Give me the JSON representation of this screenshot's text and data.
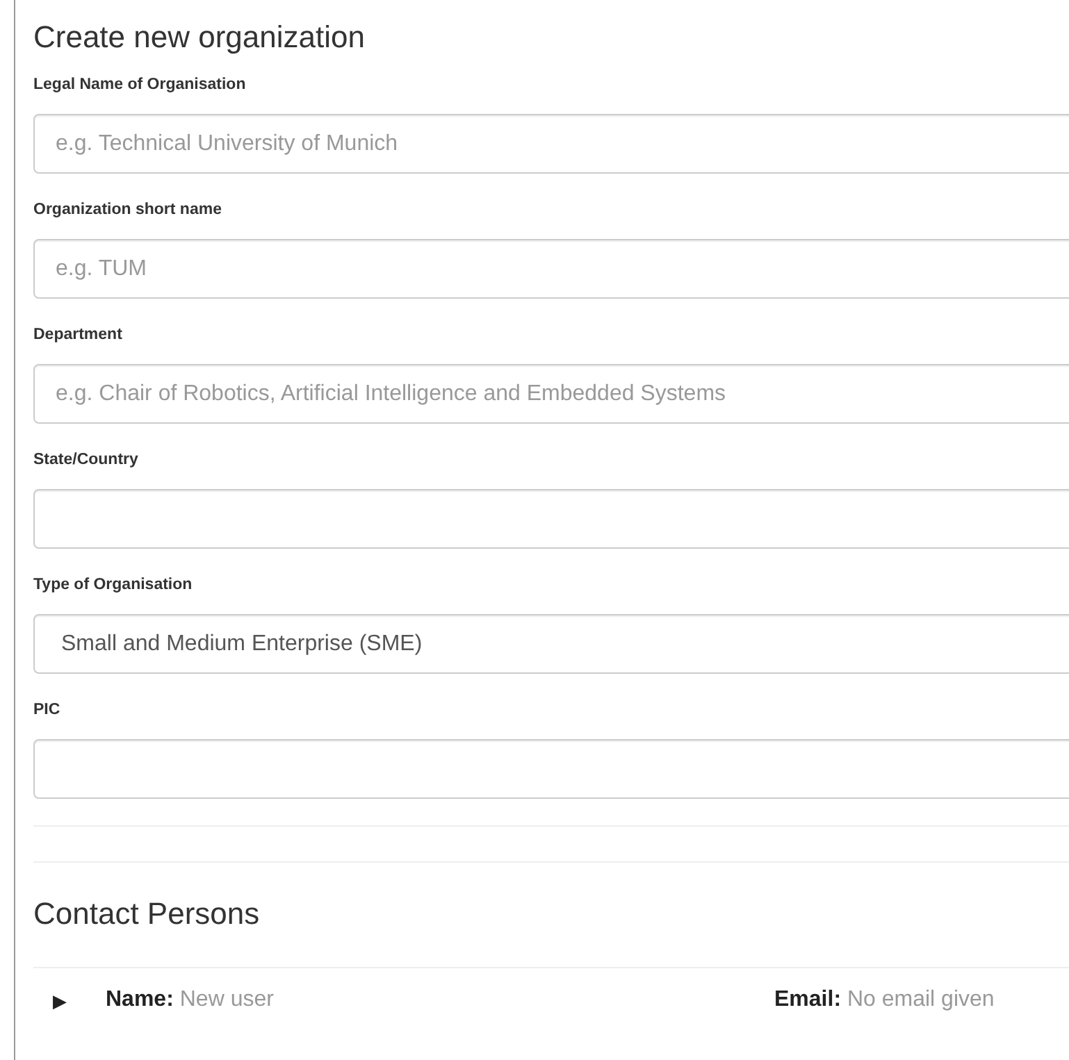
{
  "title": "Create new organization",
  "fields": [
    {
      "label": "Legal Name of Organisation",
      "kind": "text",
      "placeholder": "e.g. Technical University of Munich"
    },
    {
      "label": "Organization short name",
      "kind": "text",
      "placeholder": "e.g. TUM"
    },
    {
      "label": "Department",
      "kind": "text",
      "placeholder": "e.g. Chair of Robotics, Artificial Intelligence and Embedded Systems"
    },
    {
      "label": "State/Country",
      "kind": "text"
    },
    {
      "label": "Type of Organisation",
      "kind": "select",
      "value": "Small and Medium Enterprise (SME)"
    },
    {
      "label": "PIC",
      "kind": "text"
    }
  ],
  "contacts": {
    "title": "Contact Persons",
    "rows": [
      {
        "expander": "▶",
        "expanded": false,
        "name_label": "Name:",
        "name": "New user",
        "email_label": "Email:",
        "email": "No email given"
      }
    ]
  }
}
